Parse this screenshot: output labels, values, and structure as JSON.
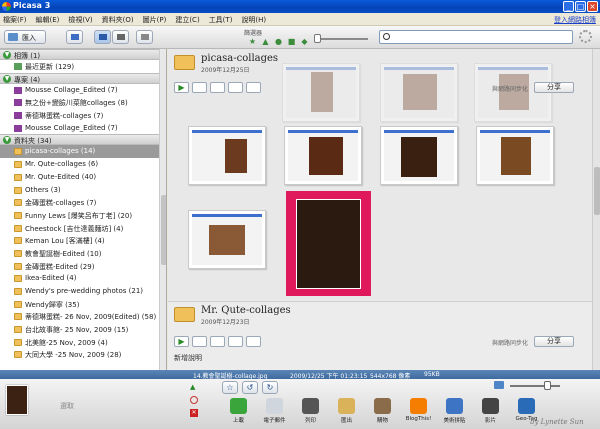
{
  "titlebar": {
    "title": "Picasa 3"
  },
  "menu": {
    "items": [
      "檔案(F)",
      "編輯(E)",
      "檢視(V)",
      "資料夾(O)",
      "圖片(P)",
      "建立(C)",
      "工具(T)",
      "說明(H)"
    ],
    "signin": "登入網路相簿"
  },
  "toolbar": {
    "import_label": "匯入",
    "filter_label": "篩選器",
    "search_value": ""
  },
  "sidebar": {
    "albums_header": "相簿 (1)",
    "albums": [
      {
        "label": "最近更新 (129)"
      }
    ],
    "projects_header": "專案 (4)",
    "projects": [
      {
        "label": "Mousse Collage_Edited (7)"
      },
      {
        "label": "無之份+變臉川菜館collages (8)"
      },
      {
        "label": "蒂德琳蛋糕-collages (7)"
      },
      {
        "label": "Mousse Collage_Edited (7)"
      }
    ],
    "folders_header": "資料夾 (34)",
    "folders": [
      {
        "label": "picasa-collages (14)"
      },
      {
        "label": "Mr. Qute-collages (6)"
      },
      {
        "label": "Mr. Qute-Edited (40)"
      },
      {
        "label": "Others (3)"
      },
      {
        "label": "金磚蛋糕-collages (7)"
      },
      {
        "label": "Funny Lews [爆笑呂布丁老] (20)"
      },
      {
        "label": "Cheestock [吉仕達義麵坊] (4)"
      },
      {
        "label": "Keman Lou [客滿樓] (4)"
      },
      {
        "label": "教會聖誕樹-Edited (10)"
      },
      {
        "label": "金磚蛋糕-Edited (29)"
      },
      {
        "label": "Ikea-Edited (4)"
      },
      {
        "label": "Wendy's pre-wedding photos (21)"
      },
      {
        "label": "Wendy歸寧 (35)"
      },
      {
        "label": "蒂德琳蛋糕- 26 Nov, 2009(Edited) (58)"
      },
      {
        "label": "台北故事館- 25 Nov, 2009 (15)"
      },
      {
        "label": "北美館-25 Nov, 2009 (4)"
      },
      {
        "label": "大同大學 -25 Nov, 2009 (28)"
      }
    ]
  },
  "albums": [
    {
      "name": "picasa-collages",
      "date": "2009年12月25日",
      "sync_label": "與網路同步化",
      "share_label": "分享"
    },
    {
      "name": "Mr. Qute-collages",
      "date": "2009年12月23日",
      "sync_label": "與網路同步化",
      "share_label": "分享",
      "note": "新增說明"
    }
  ],
  "status": {
    "filename": "14.教會聖誕樹-collage.jpg",
    "datetime": "2009/12/25 下午 01:23:15",
    "dimensions": "544x768 像素",
    "filesize": "95KB"
  },
  "tray": {
    "label": "選取",
    "actions": [
      {
        "label": "上載",
        "icon": "upload-icon",
        "color": "#3aa53a"
      },
      {
        "label": "電子郵件",
        "icon": "email-icon",
        "color": "#cfd6de"
      },
      {
        "label": "列印",
        "icon": "print-icon",
        "color": "#555555"
      },
      {
        "label": "匯出",
        "icon": "export-folder-icon",
        "color": "#d9b25a"
      },
      {
        "label": "購物",
        "icon": "shop-icon",
        "color": "#8a6b4a"
      },
      {
        "label": "BlogThis!",
        "icon": "blogger-icon",
        "color": "#f57d00"
      },
      {
        "label": "美術拼貼",
        "icon": "collage-icon",
        "color": "#3d74c4"
      },
      {
        "label": "影片",
        "icon": "movie-icon",
        "color": "#444444"
      },
      {
        "label": "Geo-Tag",
        "icon": "geotag-icon",
        "color": "#2a6bb8"
      }
    ],
    "credit": "by Lynette Sun"
  }
}
